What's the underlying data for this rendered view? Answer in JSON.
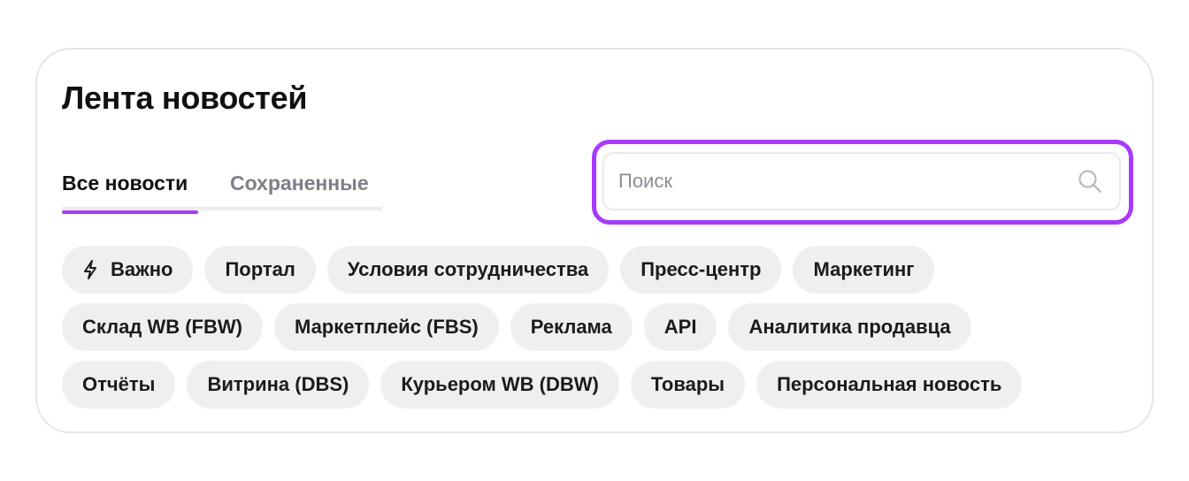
{
  "header": {
    "title": "Лента новостей"
  },
  "tabs": [
    {
      "label": "Все новости",
      "active": true
    },
    {
      "label": "Сохраненные",
      "active": false
    }
  ],
  "search": {
    "placeholder": "Поиск",
    "value": "",
    "icon": "search-icon"
  },
  "colors": {
    "accent": "#a73afd",
    "chip_bg": "#efeff2",
    "border": "#e6e6ea"
  },
  "chips": {
    "important": {
      "label": "Важно",
      "icon": "lightning-icon"
    },
    "portal": "Портал",
    "cooperation": "Условия сотрудничества",
    "press": "Пресс-центр",
    "marketing": "Маркетинг",
    "fbw": "Склад WB (FBW)",
    "fbs": "Маркетплейс (FBS)",
    "ads": "Реклама",
    "api": "API",
    "analytics": "Аналитика продавца",
    "reports": "Отчёты",
    "dbs": "Витрина (DBS)",
    "dbw": "Курьером WB (DBW)",
    "goods": "Товары",
    "personal": "Персональная новость"
  }
}
